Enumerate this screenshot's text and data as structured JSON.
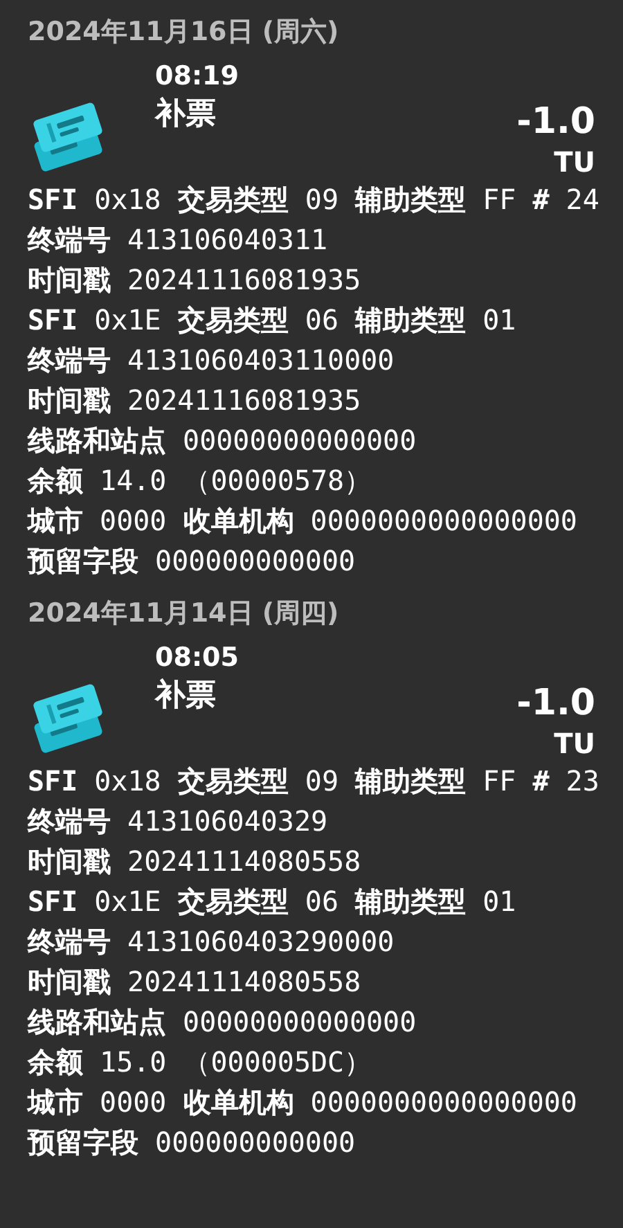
{
  "records": [
    {
      "date": "2024年11月16日 (周六)",
      "time": "08:19",
      "title": "补票",
      "amount": "-1.0",
      "unit": "TU",
      "lines": [
        "**SFI** 0x18 **交易类型** 09 **辅助类型** FF **#** 24",
        "**终端号** 413106040311",
        "**时间戳** 20241116081935",
        "**SFI** 0x1E **交易类型** 06 **辅助类型** 01",
        "**终端号** 4131060403110000",
        "**时间戳** 20241116081935",
        "**线路和站点** 00000000000000",
        "**余额** 14.0 （00000578）",
        "**城市** 0000 **收单机构** 0000000000000000",
        "**预留字段** 000000000000"
      ]
    },
    {
      "date": "2024年11月14日 (周四)",
      "time": "08:05",
      "title": "补票",
      "amount": "-1.0",
      "unit": "TU",
      "lines": [
        "**SFI** 0x18 **交易类型** 09 **辅助类型** FF **#** 23",
        "**终端号** 413106040329",
        "**时间戳** 20241114080558",
        "**SFI** 0x1E **交易类型** 06 **辅助类型** 01",
        "**终端号** 4131060403290000",
        "**时间戳** 20241114080558",
        "**线路和站点** 00000000000000",
        "**余额** 15.0 （000005DC）",
        "**城市** 0000 **收单机构** 0000000000000000",
        "**预留字段** 000000000000"
      ]
    }
  ]
}
